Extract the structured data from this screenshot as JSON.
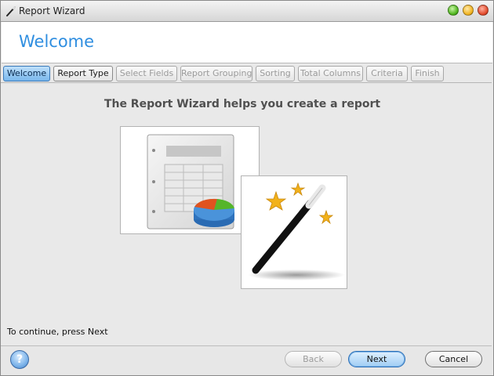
{
  "window": {
    "title": "Report Wizard",
    "title_icon": "wand-icon",
    "controls": [
      "maximize-button",
      "minimize-button",
      "close-button"
    ]
  },
  "header": {
    "title": "Welcome"
  },
  "tabs": [
    {
      "label": "Welcome",
      "state": "active"
    },
    {
      "label": "Report Type",
      "state": "enabled"
    },
    {
      "label": "Select Fields",
      "state": "disabled"
    },
    {
      "label": "Report Grouping",
      "state": "disabled"
    },
    {
      "label": "Sorting",
      "state": "disabled"
    },
    {
      "label": "Total Columns",
      "state": "disabled"
    },
    {
      "label": "Criteria",
      "state": "disabled"
    },
    {
      "label": "Finish",
      "state": "disabled"
    }
  ],
  "main": {
    "headline": "The Report Wizard helps you create a report",
    "images": [
      "report-pie-chart-icon",
      "magic-wand-stars-icon"
    ],
    "hint": "To continue, press Next"
  },
  "footer": {
    "help_icon": "help-icon",
    "back_label": "Back",
    "next_label": "Next",
    "cancel_label": "Cancel"
  },
  "colors": {
    "accent": "#2f8ee0",
    "active_tab": "#79b7ec",
    "background": "#e9e9e9"
  }
}
